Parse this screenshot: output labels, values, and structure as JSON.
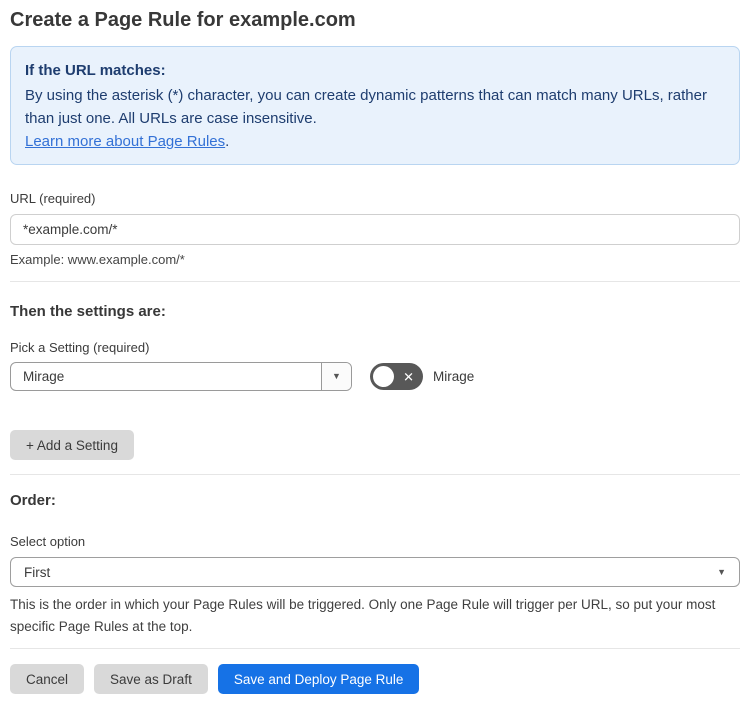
{
  "page": {
    "title": "Create a Page Rule for example.com"
  },
  "info_box": {
    "heading": "If the URL matches:",
    "body": "By using the asterisk (*) character, you can create dynamic patterns that can match many URLs, rather than just one. All URLs are case insensitive.",
    "link_label": "Learn more about Page Rules",
    "link_suffix": "."
  },
  "url_field": {
    "label": "URL (required)",
    "value": "*example.com/*",
    "example": "Example: www.example.com/*"
  },
  "settings_section": {
    "heading": "Then the settings are:",
    "picker_label": "Pick a Setting (required)",
    "picker_value": "Mirage",
    "toggle_label": "Mirage",
    "toggle_state": "off",
    "toggle_off_glyph": "✕",
    "add_button_label": "+ Add a Setting"
  },
  "order_section": {
    "heading": "Order:",
    "select_label": "Select option",
    "select_value": "First",
    "help_text": "This is the order in which your Page Rules will be triggered. Only one Page Rule will trigger per URL, so put your most specific Page Rules at the top."
  },
  "footer": {
    "cancel_label": "Cancel",
    "save_draft_label": "Save as Draft",
    "save_deploy_label": "Save and Deploy Page Rule"
  },
  "icons": {
    "dropdown_arrow": "▼"
  },
  "colors": {
    "accent_blue": "#1672e6",
    "info_background": "#e9f2fc",
    "info_border": "#b9d5f1",
    "info_text": "#1e3d6f",
    "link_blue": "#3371d6",
    "toggle_off_gray": "#585858",
    "button_gray": "#d9d9d9",
    "text_dark": "#3b3b3b"
  }
}
